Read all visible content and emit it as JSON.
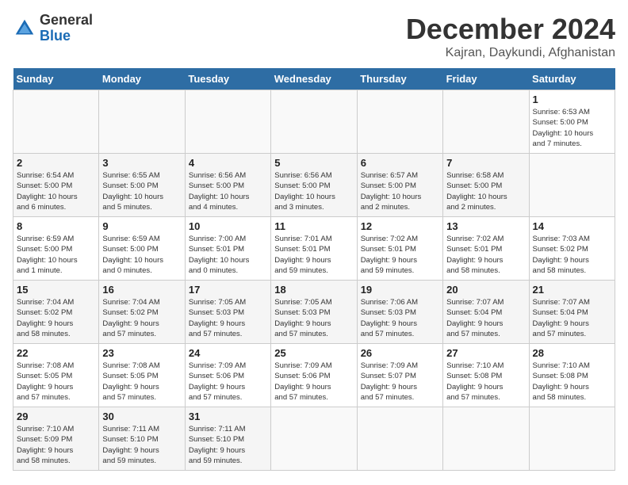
{
  "header": {
    "logo_line1": "General",
    "logo_line2": "Blue",
    "title": "December 2024",
    "subtitle": "Kajran, Daykundi, Afghanistan"
  },
  "calendar": {
    "days_of_week": [
      "Sunday",
      "Monday",
      "Tuesday",
      "Wednesday",
      "Thursday",
      "Friday",
      "Saturday"
    ],
    "weeks": [
      [
        {
          "day": "",
          "info": ""
        },
        {
          "day": "",
          "info": ""
        },
        {
          "day": "",
          "info": ""
        },
        {
          "day": "",
          "info": ""
        },
        {
          "day": "",
          "info": ""
        },
        {
          "day": "",
          "info": ""
        },
        {
          "day": "1",
          "info": "Sunrise: 6:53 AM\nSunset: 5:00 PM\nDaylight: 10 hours\nand 7 minutes."
        }
      ],
      [
        {
          "day": "2",
          "info": "Sunrise: 6:54 AM\nSunset: 5:00 PM\nDaylight: 10 hours\nand 6 minutes."
        },
        {
          "day": "3",
          "info": "Sunrise: 6:55 AM\nSunset: 5:00 PM\nDaylight: 10 hours\nand 5 minutes."
        },
        {
          "day": "4",
          "info": "Sunrise: 6:56 AM\nSunset: 5:00 PM\nDaylight: 10 hours\nand 4 minutes."
        },
        {
          "day": "5",
          "info": "Sunrise: 6:56 AM\nSunset: 5:00 PM\nDaylight: 10 hours\nand 3 minutes."
        },
        {
          "day": "6",
          "info": "Sunrise: 6:57 AM\nSunset: 5:00 PM\nDaylight: 10 hours\nand 2 minutes."
        },
        {
          "day": "7",
          "info": "Sunrise: 6:58 AM\nSunset: 5:00 PM\nDaylight: 10 hours\nand 2 minutes."
        },
        {
          "day": "",
          "info": ""
        }
      ],
      [
        {
          "day": "8",
          "info": "Sunrise: 6:59 AM\nSunset: 5:00 PM\nDaylight: 10 hours\nand 1 minute."
        },
        {
          "day": "9",
          "info": "Sunrise: 6:59 AM\nSunset: 5:00 PM\nDaylight: 10 hours\nand 0 minutes."
        },
        {
          "day": "10",
          "info": "Sunrise: 7:00 AM\nSunset: 5:01 PM\nDaylight: 10 hours\nand 0 minutes."
        },
        {
          "day": "11",
          "info": "Sunrise: 7:01 AM\nSunset: 5:01 PM\nDaylight: 9 hours\nand 59 minutes."
        },
        {
          "day": "12",
          "info": "Sunrise: 7:02 AM\nSunset: 5:01 PM\nDaylight: 9 hours\nand 59 minutes."
        },
        {
          "day": "13",
          "info": "Sunrise: 7:02 AM\nSunset: 5:01 PM\nDaylight: 9 hours\nand 58 minutes."
        },
        {
          "day": "14",
          "info": "Sunrise: 7:03 AM\nSunset: 5:02 PM\nDaylight: 9 hours\nand 58 minutes."
        }
      ],
      [
        {
          "day": "15",
          "info": "Sunrise: 7:04 AM\nSunset: 5:02 PM\nDaylight: 9 hours\nand 58 minutes."
        },
        {
          "day": "16",
          "info": "Sunrise: 7:04 AM\nSunset: 5:02 PM\nDaylight: 9 hours\nand 57 minutes."
        },
        {
          "day": "17",
          "info": "Sunrise: 7:05 AM\nSunset: 5:03 PM\nDaylight: 9 hours\nand 57 minutes."
        },
        {
          "day": "18",
          "info": "Sunrise: 7:05 AM\nSunset: 5:03 PM\nDaylight: 9 hours\nand 57 minutes."
        },
        {
          "day": "19",
          "info": "Sunrise: 7:06 AM\nSunset: 5:03 PM\nDaylight: 9 hours\nand 57 minutes."
        },
        {
          "day": "20",
          "info": "Sunrise: 7:07 AM\nSunset: 5:04 PM\nDaylight: 9 hours\nand 57 minutes."
        },
        {
          "day": "21",
          "info": "Sunrise: 7:07 AM\nSunset: 5:04 PM\nDaylight: 9 hours\nand 57 minutes."
        }
      ],
      [
        {
          "day": "22",
          "info": "Sunrise: 7:08 AM\nSunset: 5:05 PM\nDaylight: 9 hours\nand 57 minutes."
        },
        {
          "day": "23",
          "info": "Sunrise: 7:08 AM\nSunset: 5:05 PM\nDaylight: 9 hours\nand 57 minutes."
        },
        {
          "day": "24",
          "info": "Sunrise: 7:09 AM\nSunset: 5:06 PM\nDaylight: 9 hours\nand 57 minutes."
        },
        {
          "day": "25",
          "info": "Sunrise: 7:09 AM\nSunset: 5:06 PM\nDaylight: 9 hours\nand 57 minutes."
        },
        {
          "day": "26",
          "info": "Sunrise: 7:09 AM\nSunset: 5:07 PM\nDaylight: 9 hours\nand 57 minutes."
        },
        {
          "day": "27",
          "info": "Sunrise: 7:10 AM\nSunset: 5:08 PM\nDaylight: 9 hours\nand 57 minutes."
        },
        {
          "day": "28",
          "info": "Sunrise: 7:10 AM\nSunset: 5:08 PM\nDaylight: 9 hours\nand 58 minutes."
        }
      ],
      [
        {
          "day": "29",
          "info": "Sunrise: 7:10 AM\nSunset: 5:09 PM\nDaylight: 9 hours\nand 58 minutes."
        },
        {
          "day": "30",
          "info": "Sunrise: 7:11 AM\nSunset: 5:10 PM\nDaylight: 9 hours\nand 59 minutes."
        },
        {
          "day": "31",
          "info": "Sunrise: 7:11 AM\nSunset: 5:10 PM\nDaylight: 9 hours\nand 59 minutes."
        },
        {
          "day": "",
          "info": ""
        },
        {
          "day": "",
          "info": ""
        },
        {
          "day": "",
          "info": ""
        },
        {
          "day": "",
          "info": ""
        }
      ]
    ]
  }
}
